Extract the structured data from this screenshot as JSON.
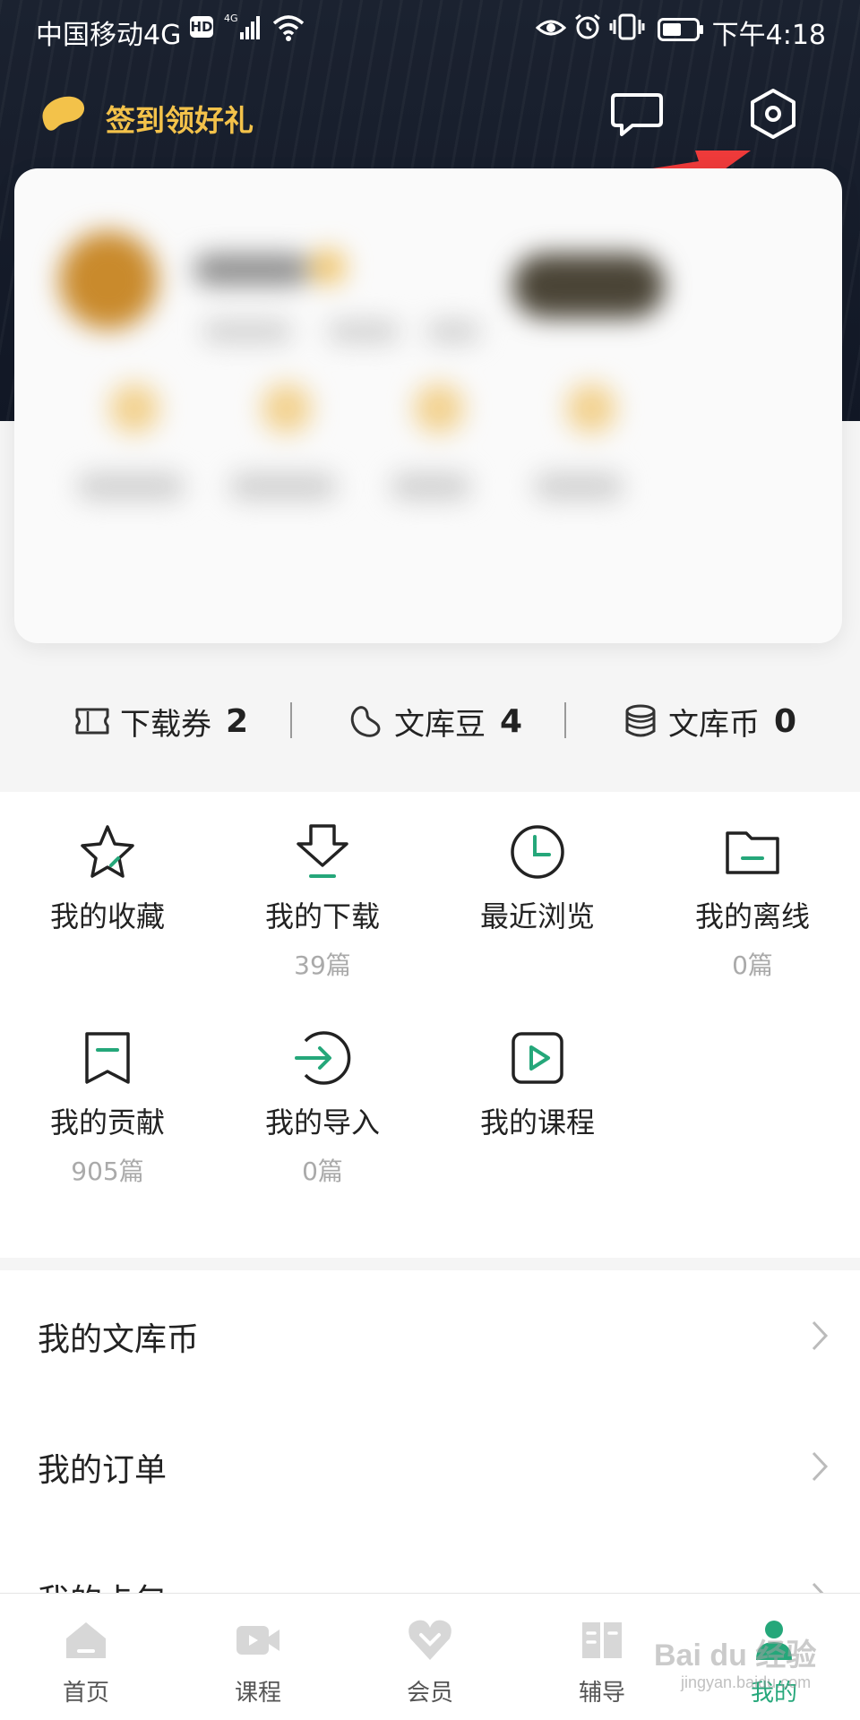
{
  "status_bar": {
    "carrier": "中国移动4G",
    "hd": "HD",
    "time": "下午4:18"
  },
  "header": {
    "signin_label": "签到领好礼",
    "icons": {
      "signin": "bean-icon",
      "messages": "message-icon",
      "settings": "settings-icon"
    },
    "accent": "#f3c24a"
  },
  "stats": [
    {
      "label": "下载券",
      "value": "2",
      "icon": "ticket-icon"
    },
    {
      "label": "文库豆",
      "value": "4",
      "icon": "bean-outline-icon"
    },
    {
      "label": "文库币",
      "value": "0",
      "icon": "coins-icon"
    }
  ],
  "features": [
    {
      "label": "我的收藏",
      "count": "",
      "icon": "star-icon"
    },
    {
      "label": "我的下载",
      "count": "39篇",
      "icon": "download-icon"
    },
    {
      "label": "最近浏览",
      "count": "",
      "icon": "clock-icon"
    },
    {
      "label": "我的离线",
      "count": "0篇",
      "icon": "folder-icon"
    },
    {
      "label": "我的贡献",
      "count": "905篇",
      "icon": "bookmark-icon"
    },
    {
      "label": "我的导入",
      "count": "0篇",
      "icon": "import-icon"
    },
    {
      "label": "我的课程",
      "count": "",
      "icon": "play-icon"
    }
  ],
  "list": [
    {
      "label": "我的文库币"
    },
    {
      "label": "我的订单"
    },
    {
      "label": "我的卡包"
    }
  ],
  "bottom_nav": {
    "active_color": "#25a77a",
    "items": [
      {
        "label": "首页",
        "icon": "home-icon"
      },
      {
        "label": "课程",
        "icon": "video-icon"
      },
      {
        "label": "会员",
        "icon": "vip-icon"
      },
      {
        "label": "辅导",
        "icon": "book-icon"
      },
      {
        "label": "我的",
        "icon": "profile-icon"
      }
    ]
  },
  "watermark": {
    "text": "Bai du 经验",
    "sub": "jingyan.baidu.com"
  }
}
